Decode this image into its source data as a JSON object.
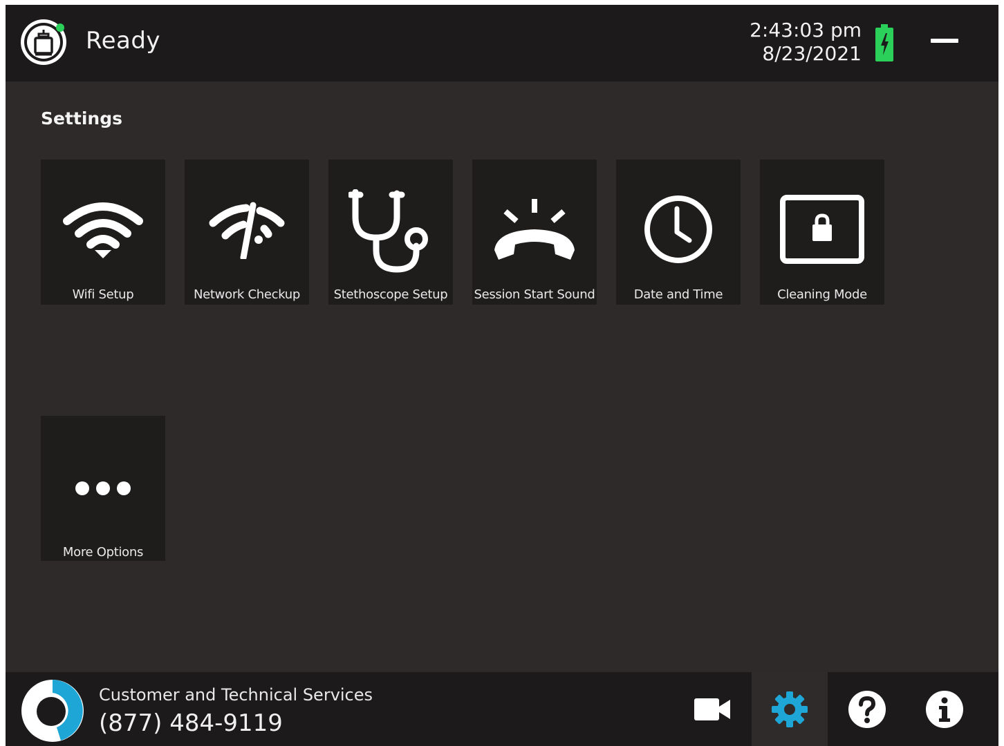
{
  "header": {
    "status": "Ready",
    "time": "2:43:03 pm",
    "date": "8/23/2021",
    "status_color": "#2bd05a",
    "battery_color": "#2bd05a"
  },
  "settings": {
    "title": "Settings",
    "tiles": [
      {
        "label": "Wifi Setup",
        "icon": "wifi-icon"
      },
      {
        "label": "Network Checkup",
        "icon": "network-checkup-icon"
      },
      {
        "label": "Stethoscope Setup",
        "icon": "stethoscope-icon"
      },
      {
        "label": "Session Start Sound",
        "icon": "phone-ring-icon"
      },
      {
        "label": "Date and Time",
        "icon": "clock-icon"
      },
      {
        "label": "Cleaning Mode",
        "icon": "screen-lock-icon"
      },
      {
        "label": "More Options",
        "icon": "ellipsis-icon"
      }
    ]
  },
  "footer": {
    "support_title": "Customer and Technical Services",
    "support_phone": "(877) 484-9119",
    "buttons": [
      {
        "name": "video",
        "icon": "video-camera-icon"
      },
      {
        "name": "settings",
        "icon": "gear-icon",
        "active": true,
        "color": "#1ea7d6"
      },
      {
        "name": "help",
        "icon": "question-icon"
      },
      {
        "name": "info",
        "icon": "info-icon"
      }
    ]
  }
}
